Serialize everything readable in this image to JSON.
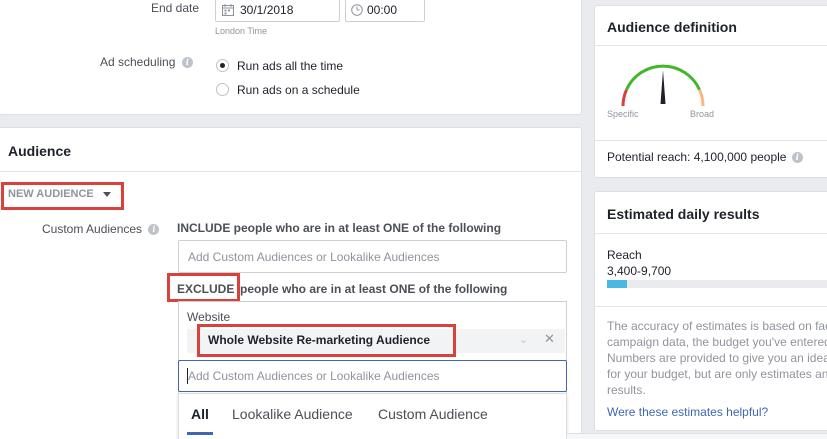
{
  "schedule": {
    "end_date_label": "End date",
    "end_date_value": "30/1/2018",
    "end_time_value": "00:00",
    "timezone": "London Time",
    "ad_scheduling_label": "Ad scheduling",
    "option_all_time": "Run ads all the time",
    "option_schedule": "Run ads on a schedule"
  },
  "audience": {
    "title": "Audience",
    "new_audience": "NEW AUDIENCE",
    "custom_audiences_label": "Custom Audiences",
    "include_text": "INCLUDE people who are in at least ONE of the following",
    "include_placeholder": "Add Custom Audiences or Lookalike Audiences",
    "exclude_word": "EXCLUDE",
    "exclude_text": "people who are in at least ONE of the following",
    "exclude_group_label": "Website",
    "excluded_audience": "Whole Website Re-marketing Audience",
    "exclude_placeholder": "Add Custom Audiences or Lookalike Audiences",
    "tabs": [
      "All",
      "Lookalike Audience",
      "Custom Audience"
    ],
    "active_tab": "All"
  },
  "definition": {
    "title": "Audience definition",
    "gauge_left": "Specific",
    "gauge_right": "Broad",
    "potential_reach": "Potential reach: 4,100,000 people"
  },
  "estimates": {
    "title": "Estimated daily results",
    "reach_label": "Reach",
    "reach_value": "3,400-9,700",
    "reach_bar_fraction": 0.085,
    "disclaimer_lines": [
      "The accuracy of estimates is based on fac",
      "campaign data, the budget you've entered",
      "Numbers are provided to give you an idea",
      "for your budget, but are only estimates an",
      "results."
    ],
    "helpful_link": "Were these estimates helpful?"
  },
  "colors": {
    "accent": "#4267b2",
    "highlight": "#d9413b",
    "reach_bar": "#4ab8e4"
  }
}
